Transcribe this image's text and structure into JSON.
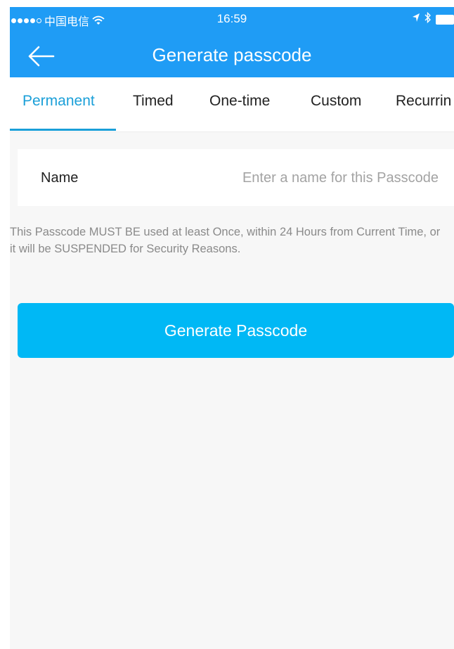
{
  "status_bar": {
    "carrier": "中国电信",
    "time": "16:59",
    "icons": [
      "wifi-icon",
      "location-arrow-icon",
      "bluetooth-icon",
      "battery-icon"
    ]
  },
  "navbar": {
    "back_icon": "arrow-left-icon",
    "title": "Generate passcode"
  },
  "tabs": [
    {
      "label": "Permanent",
      "active": true
    },
    {
      "label": "Timed",
      "active": false
    },
    {
      "label": "One-time",
      "active": false
    },
    {
      "label": "Custom",
      "active": false
    },
    {
      "label": "Recurrin",
      "active": false
    }
  ],
  "form": {
    "name_label": "Name",
    "name_value": "",
    "name_placeholder": "Enter a name for this Passcode"
  },
  "notice": "This Passcode MUST BE used at least Once, within 24 Hours from Current Time, or it will be SUSPENDED for Security Reasons.",
  "generate_button": "Generate Passcode",
  "colors": {
    "header": "#1f9cf5",
    "accent": "#1a9fd8",
    "button": "#00b8f5",
    "background": "#f7f7f7"
  }
}
